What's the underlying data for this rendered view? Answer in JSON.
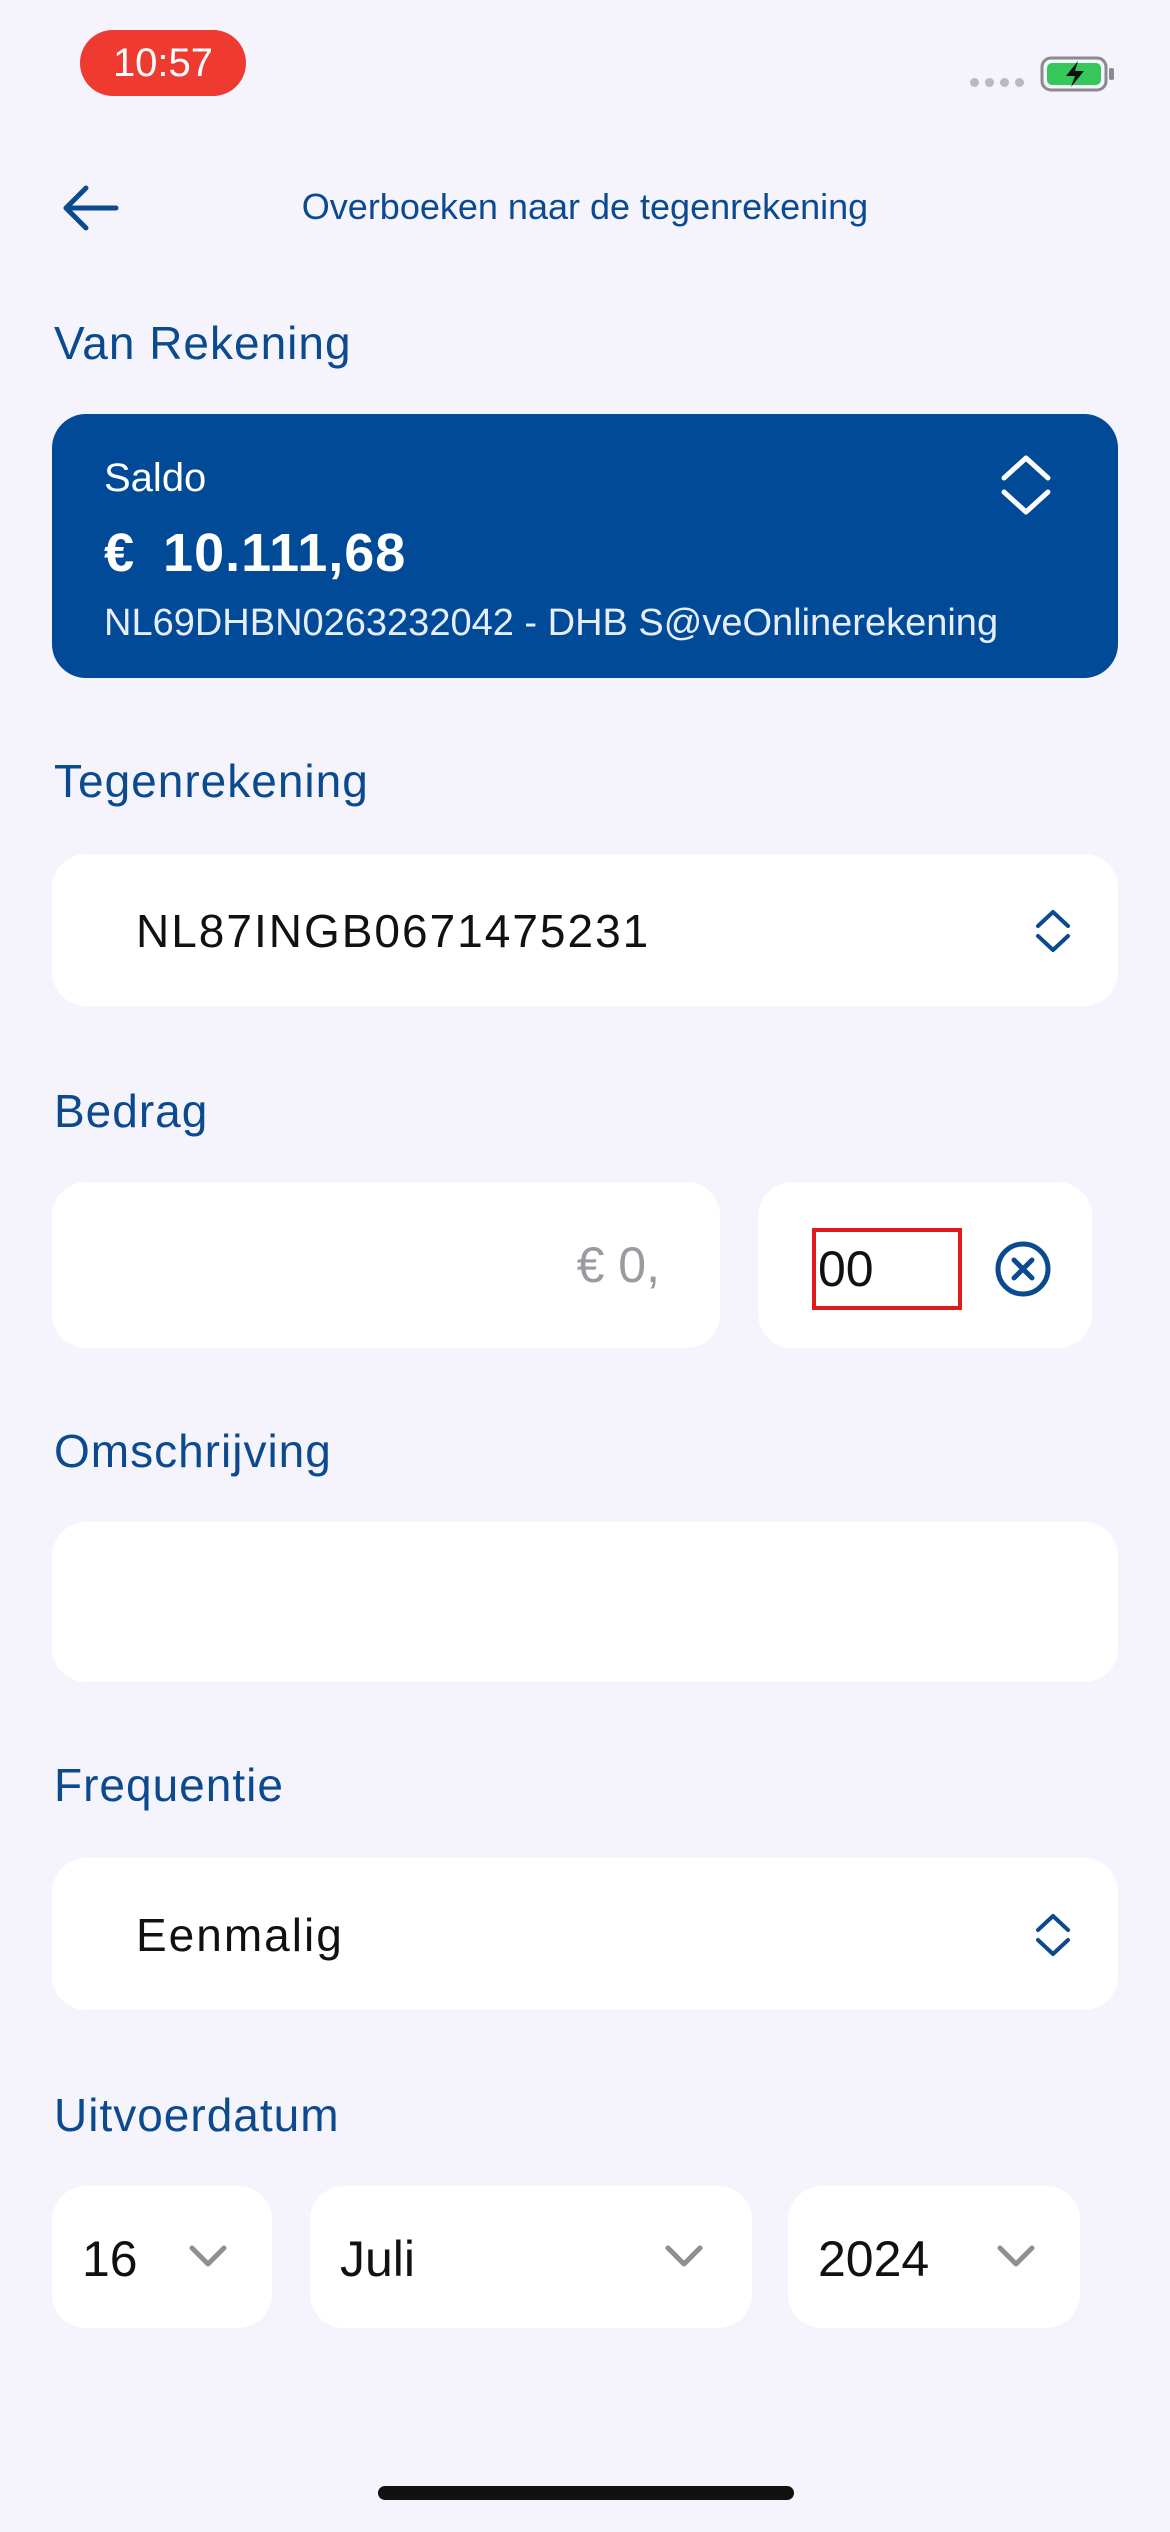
{
  "status_bar": {
    "time": "10:57"
  },
  "header": {
    "title": "Overboeken naar de tegenrekening"
  },
  "from_account": {
    "section_label": "Van Rekening",
    "saldo_label": "Saldo",
    "currency": "€",
    "amount": "10.111,68",
    "iban_line": "NL69DHBN0263232042 - DHB S@veOnlinerekening"
  },
  "counter_account": {
    "section_label": "Tegenrekening",
    "value": "NL87INGB0671475231"
  },
  "amount": {
    "section_label": "Bedrag",
    "euros_placeholder": "€ 0,",
    "cents_value": "00"
  },
  "description": {
    "section_label": "Omschrijving",
    "value": ""
  },
  "frequency": {
    "section_label": "Frequentie",
    "value": "Eenmalig"
  },
  "execution_date": {
    "section_label": "Uitvoerdatum",
    "day": "16",
    "month": "Juli",
    "year": "2024"
  },
  "colors": {
    "accent": "#0b4a8f",
    "card_background": "#014a97",
    "page_background": "#f5f3fc",
    "time_pill": "#ee3a30",
    "highlight_box": "#e01b1b"
  },
  "icons": {
    "back": "arrow-left-icon",
    "account_toggle": "chevron-up-down-icon",
    "select": "chevron-up-down-icon",
    "clear": "close-circle-icon",
    "dropdown": "chevron-down-icon",
    "battery": "battery-charging-icon"
  }
}
